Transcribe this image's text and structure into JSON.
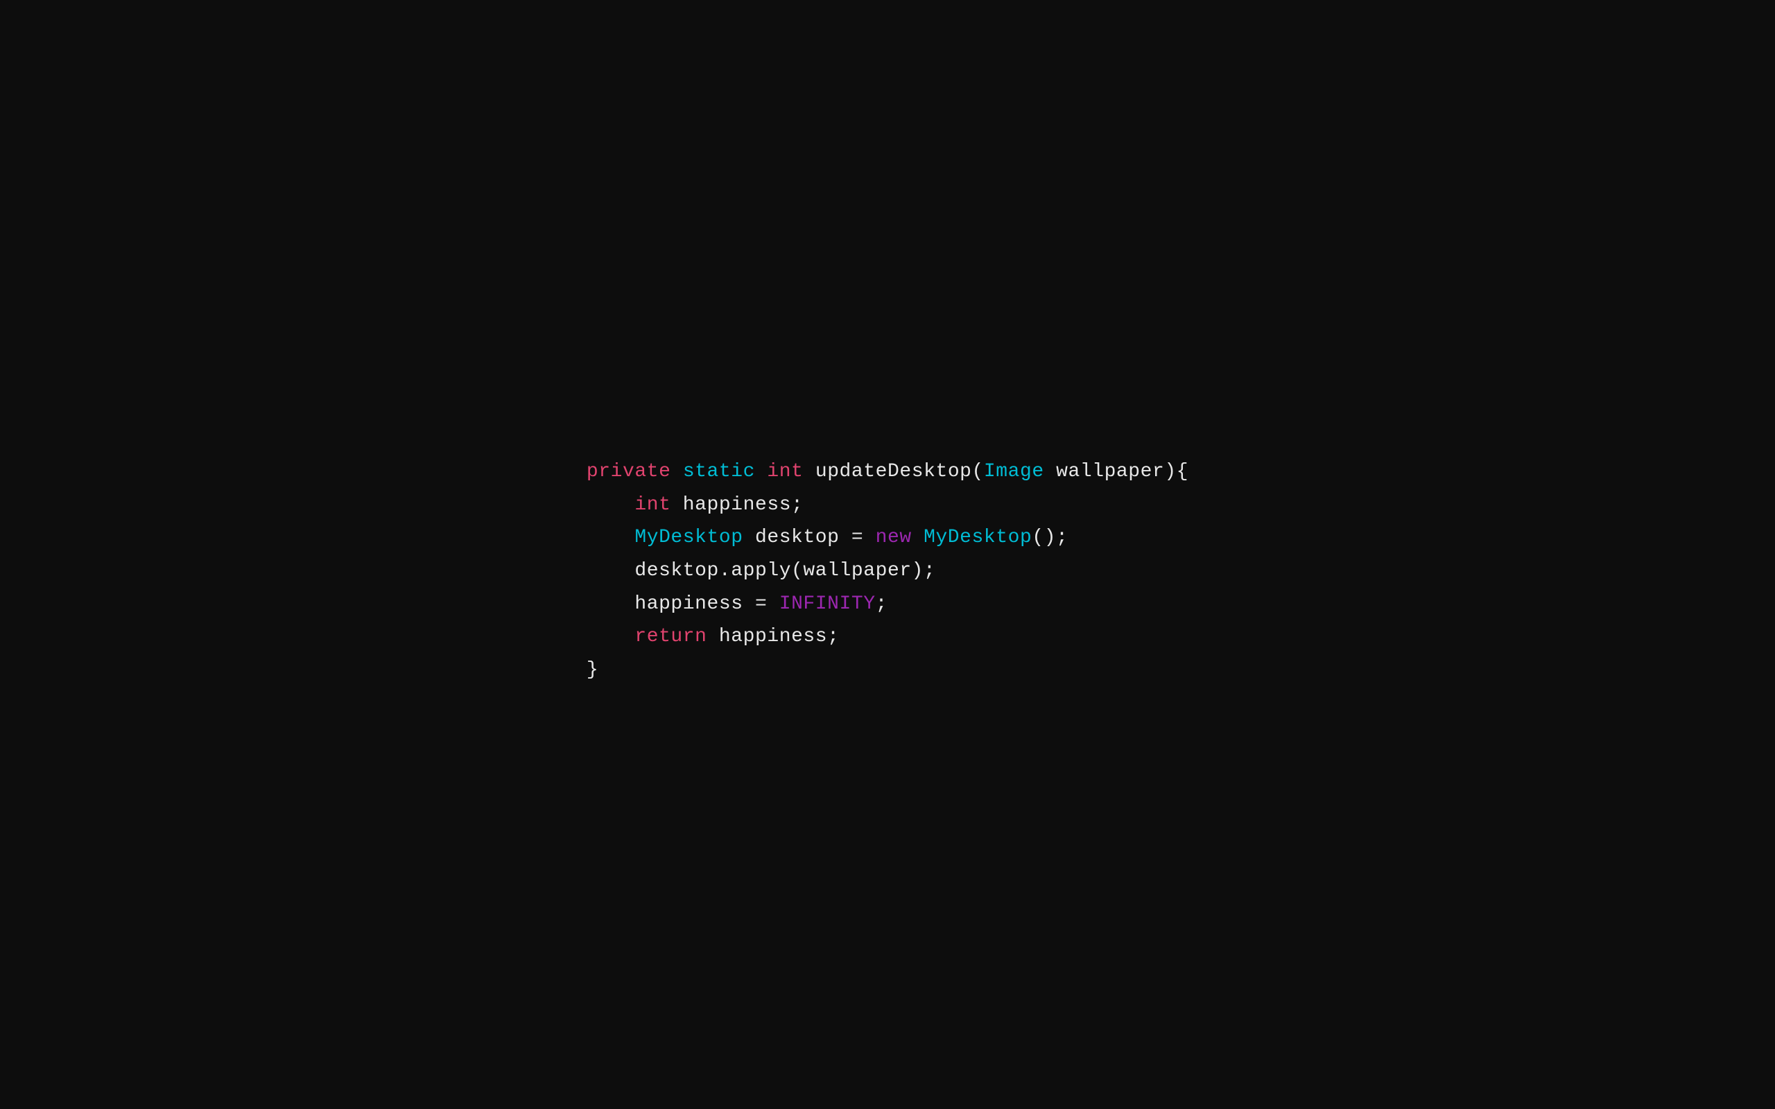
{
  "background": "#0d0d0d",
  "code": {
    "lines": [
      {
        "id": "line1",
        "parts": [
          {
            "text": "private",
            "class": "keyword-private"
          },
          {
            "text": " ",
            "class": "plain"
          },
          {
            "text": "static",
            "class": "keyword-static"
          },
          {
            "text": " ",
            "class": "plain"
          },
          {
            "text": "int",
            "class": "keyword-int"
          },
          {
            "text": " updateDesktop(",
            "class": "plain"
          },
          {
            "text": "Image",
            "class": "type-image"
          },
          {
            "text": " wallpaper){",
            "class": "plain"
          }
        ]
      },
      {
        "id": "line2",
        "parts": [
          {
            "text": "    ",
            "class": "plain"
          },
          {
            "text": "int",
            "class": "keyword-int2"
          },
          {
            "text": " happiness;",
            "class": "plain"
          }
        ]
      },
      {
        "id": "line3",
        "parts": [
          {
            "text": "    ",
            "class": "plain"
          },
          {
            "text": "MyDesktop",
            "class": "type-mydesktop"
          },
          {
            "text": " desktop = ",
            "class": "plain"
          },
          {
            "text": "new",
            "class": "keyword-new"
          },
          {
            "text": " ",
            "class": "plain"
          },
          {
            "text": "MyDesktop",
            "class": "type-mydesktop"
          },
          {
            "text": "();",
            "class": "plain"
          }
        ]
      },
      {
        "id": "line4",
        "parts": [
          {
            "text": "    desktop.apply(wallpaper);",
            "class": "plain"
          }
        ]
      },
      {
        "id": "line5",
        "parts": [
          {
            "text": "    happiness = ",
            "class": "plain"
          },
          {
            "text": "INFINITY",
            "class": "constant"
          },
          {
            "text": ";",
            "class": "plain"
          }
        ]
      },
      {
        "id": "line6",
        "parts": [
          {
            "text": "    ",
            "class": "plain"
          },
          {
            "text": "return",
            "class": "keyword-return"
          },
          {
            "text": " happiness;",
            "class": "plain"
          }
        ]
      },
      {
        "id": "line7",
        "parts": [
          {
            "text": "}",
            "class": "plain"
          }
        ]
      }
    ]
  }
}
